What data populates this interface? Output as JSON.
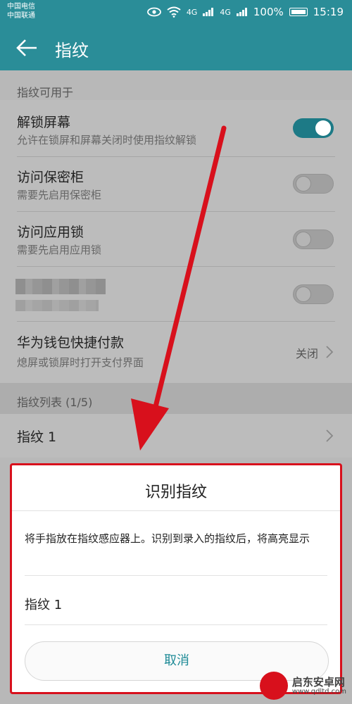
{
  "status_bar": {
    "carrier_1": "中国电信",
    "carrier_2": "中国联通",
    "signal_1": "4G",
    "signal_2": "4G",
    "battery": "100%",
    "time": "15:19",
    "icons": [
      "eye-icon",
      "wifi-icon",
      "signal-icon",
      "battery-icon"
    ]
  },
  "app_bar": {
    "title": "指纹",
    "back_icon": "arrow-left-icon"
  },
  "section_usage": {
    "header": "指纹可用于",
    "items": [
      {
        "title": "解锁屏幕",
        "subtitle": "允许在锁屏和屏幕关闭时使用指纹解锁",
        "toggle": true
      },
      {
        "title": "访问保密柜",
        "subtitle": "需要先启用保密柜",
        "toggle": false
      },
      {
        "title": "访问应用锁",
        "subtitle": "需要先启用应用锁",
        "toggle": false
      },
      {
        "title": "",
        "subtitle": "",
        "toggle": false,
        "redacted": true
      },
      {
        "title": "华为钱包快捷付款",
        "subtitle": "熄屏或锁屏时打开支付界面",
        "value": "关闭"
      }
    ]
  },
  "section_list": {
    "header": "指纹列表 (1/5)",
    "items": [
      {
        "title": "指纹 1"
      }
    ]
  },
  "dialog": {
    "title": "识别指纹",
    "message": "将手指放在指纹感应器上。识别到录入的指纹后，将高亮显示",
    "item": "指纹 1",
    "cancel_label": "取消"
  },
  "annotation": {
    "color": "#d8101c"
  },
  "watermark": {
    "site_name": "启东安卓网",
    "url": "www.qdltd.com"
  },
  "colors": {
    "accent": "#2a8d98",
    "toggle_on": "#1d7a86"
  }
}
